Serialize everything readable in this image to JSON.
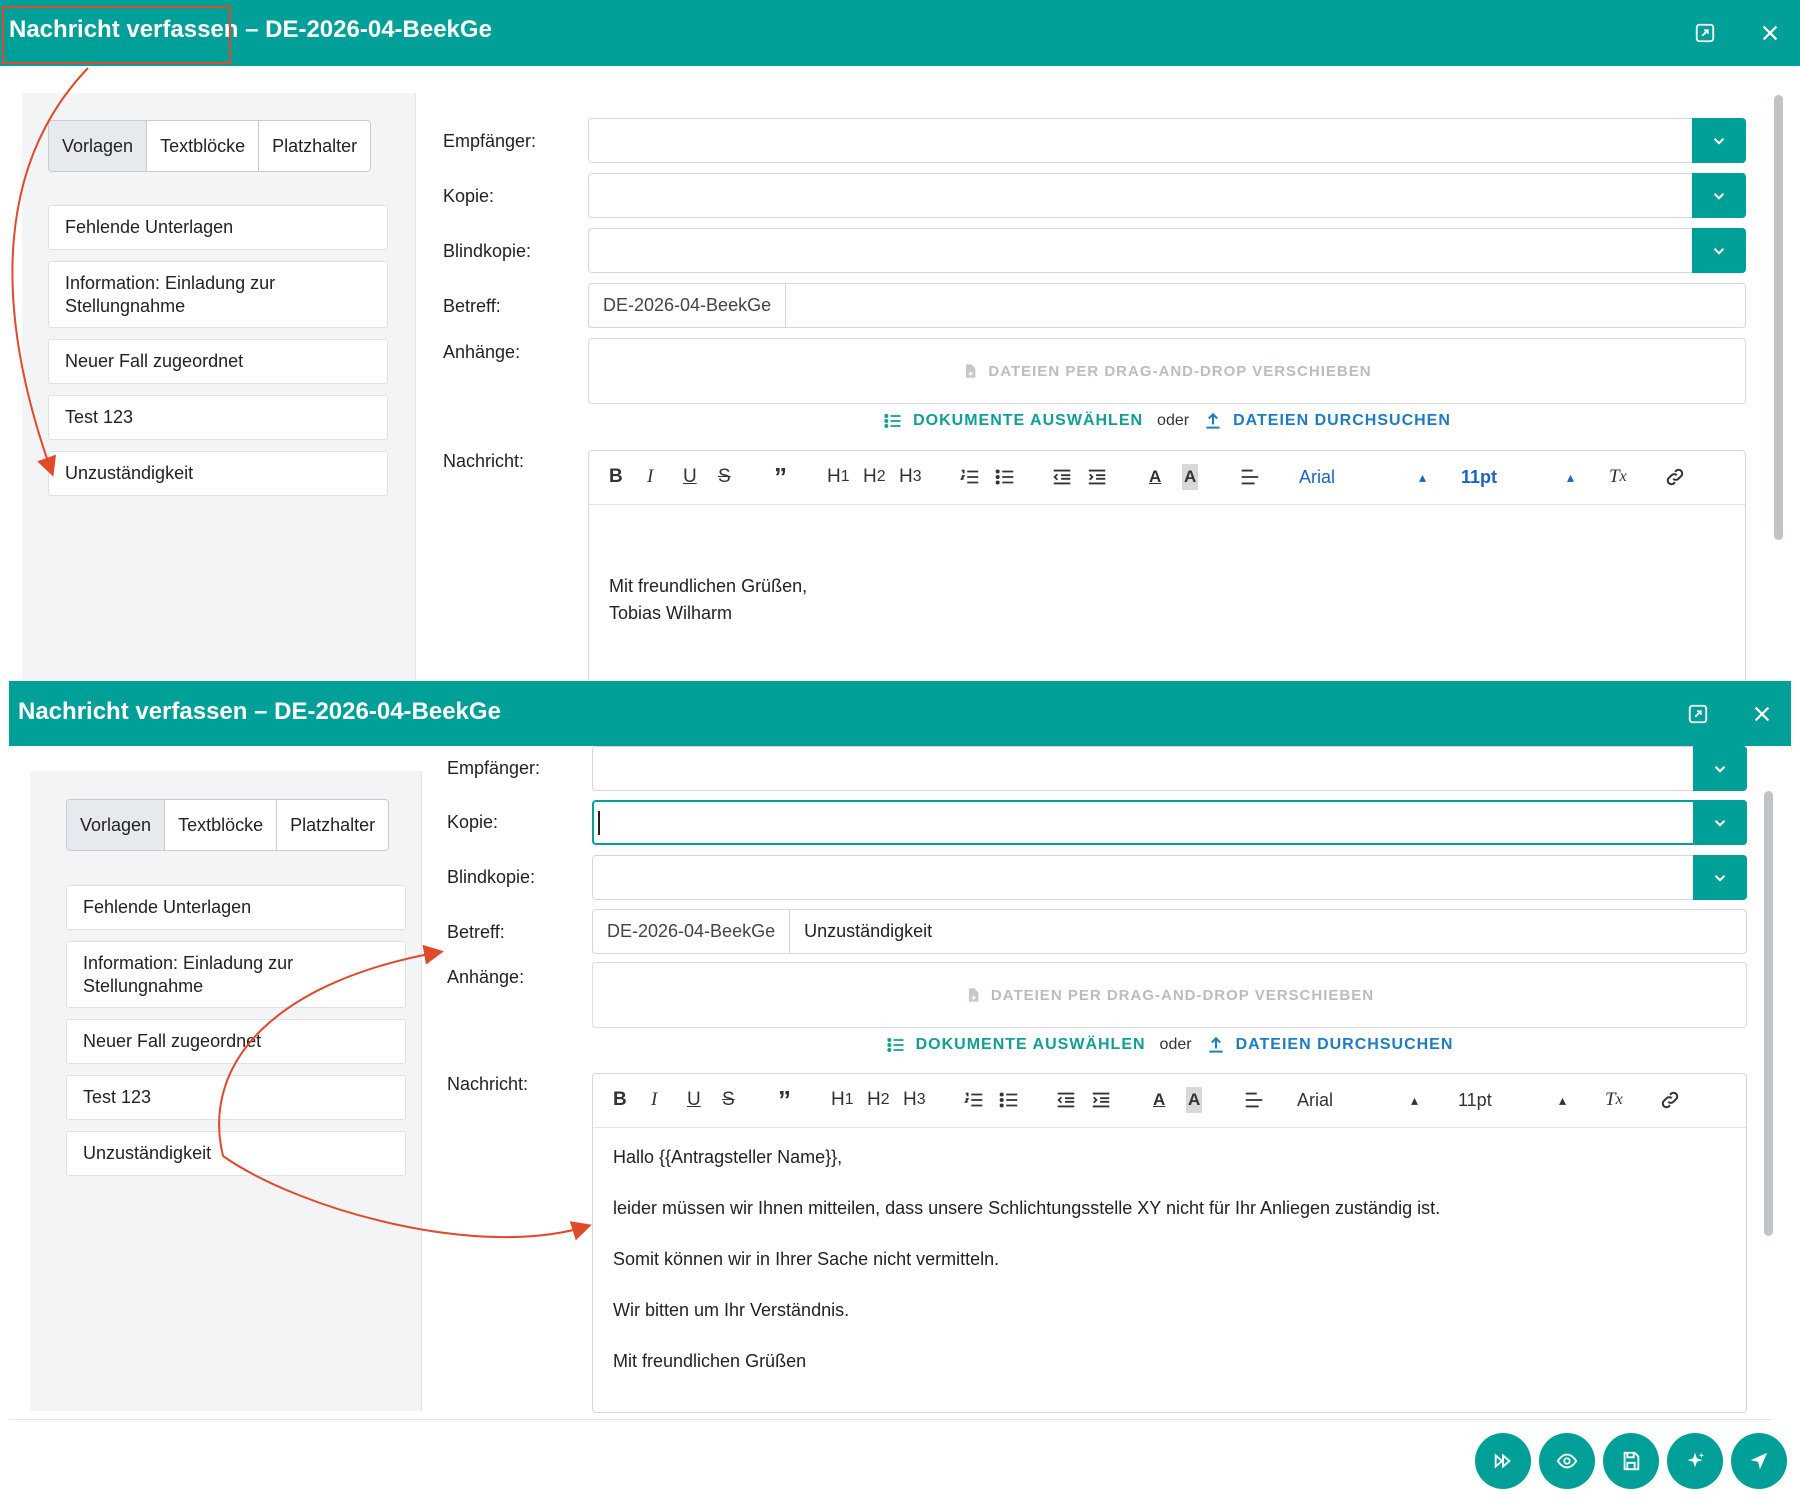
{
  "window1": {
    "title": "Nachricht verfassen – DE-2026-04-BeekGe",
    "tabs": [
      {
        "label": "Vorlagen",
        "active": true
      },
      {
        "label": "Textblöcke",
        "active": false
      },
      {
        "label": "Platzhalter",
        "active": false
      }
    ],
    "templates": [
      "Fehlende Unterlagen",
      "Information: Einladung zur Stellungnahme",
      "Neuer Fall zugeordnet",
      "Test 123",
      "Unzuständigkeit"
    ],
    "fields": {
      "recipient_label": "Empfänger:",
      "cc_label": "Kopie:",
      "bcc_label": "Blindkopie:",
      "subject_label": "Betreff:",
      "attachments_label": "Anhänge:",
      "message_label": "Nachricht:",
      "subject_prefix": "DE-2026-04-BeekGe",
      "subject_value": ""
    },
    "dropzone_text": "DATEIEN PER DRAG-AND-DROP VERSCHIEBEN",
    "select_documents": "DOKUMENTE AUSWÄHLEN",
    "or_text": "oder",
    "browse_files": "DATEIEN DURCHSUCHEN",
    "toolbar": {
      "font": "Arial",
      "size": "11pt"
    },
    "body_lines": [
      "Mit freundlichen Grüßen,",
      "Tobias Wilharm"
    ]
  },
  "window2": {
    "title": "Nachricht verfassen – DE-2026-04-BeekGe",
    "tabs": [
      {
        "label": "Vorlagen",
        "active": true
      },
      {
        "label": "Textblöcke",
        "active": false
      },
      {
        "label": "Platzhalter",
        "active": false
      }
    ],
    "templates": [
      "Fehlende Unterlagen",
      "Information: Einladung zur Stellungnahme",
      "Neuer Fall zugeordnet",
      "Test 123",
      "Unzuständigkeit"
    ],
    "fields": {
      "recipient_label": "Empfänger:",
      "cc_label": "Kopie:",
      "bcc_label": "Blindkopie:",
      "subject_label": "Betreff:",
      "attachments_label": "Anhänge:",
      "message_label": "Nachricht:",
      "subject_prefix": "DE-2026-04-BeekGe",
      "subject_value": "Unzuständigkeit"
    },
    "dropzone_text": "DATEIEN PER DRAG-AND-DROP VERSCHIEBEN",
    "select_documents": "DOKUMENTE AUSWÄHLEN",
    "or_text": "oder",
    "browse_files": "DATEIEN DURCHSUCHEN",
    "toolbar": {
      "font": "Arial",
      "size": "11pt"
    },
    "body_lines": [
      "Hallo {{Antragsteller Name}},",
      "leider müssen wir Ihnen mitteilen, dass unsere Schlichtungsstelle XY nicht für Ihr Anliegen zuständig ist.",
      "Somit können wir in Ihrer Sache nicht vermitteln.",
      "Wir bitten um Ihr Verständnis.",
      "Mit freundlichen Grüßen"
    ],
    "footer_buttons": [
      "skip-forward-icon",
      "eye-icon",
      "save-icon",
      "sparkle-icon",
      "send-icon"
    ]
  },
  "colors": {
    "teal": "#00a099",
    "annotation_red": "#e04a2a",
    "link_blue": "#1e7cc5",
    "font_select_blue": "#1a63c9"
  }
}
